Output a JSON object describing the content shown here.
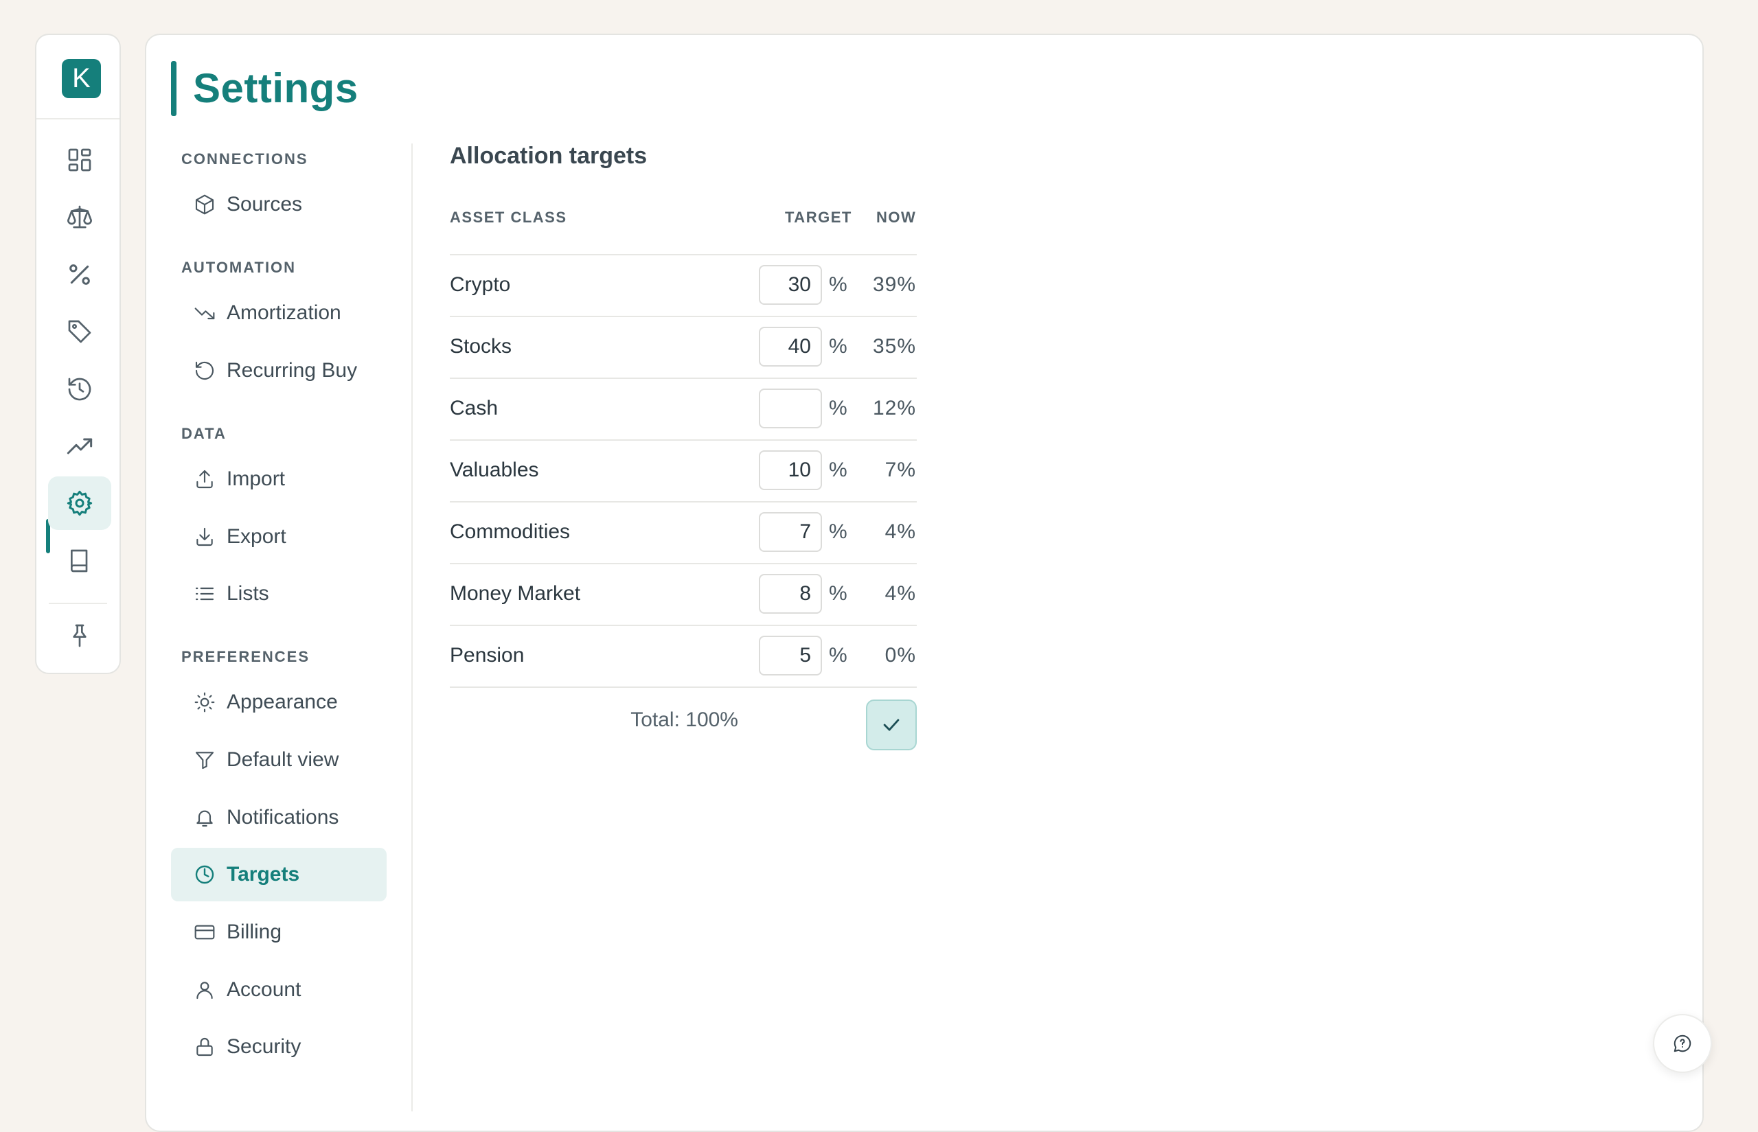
{
  "app": {
    "logo_letter": "K",
    "accent": "#157f7b"
  },
  "rail": {
    "items": [
      {
        "icon": "dashboard-icon"
      },
      {
        "icon": "scale-icon"
      },
      {
        "icon": "percent-icon"
      },
      {
        "icon": "tag-icon"
      },
      {
        "icon": "history-icon"
      },
      {
        "icon": "trend-up-icon"
      },
      {
        "icon": "gear-icon",
        "active": true
      },
      {
        "icon": "book-icon"
      },
      {
        "icon": "pin-icon"
      }
    ]
  },
  "page": {
    "title": "Settings"
  },
  "settings_nav": {
    "sections": {
      "connections": "CONNECTIONS",
      "automation": "AUTOMATION",
      "data": "DATA",
      "preferences": "PREFERENCES"
    },
    "items": {
      "sources": "Sources",
      "amortization": "Amortization",
      "recurring_buy": "Recurring Buy",
      "import": "Import",
      "export": "Export",
      "lists": "Lists",
      "appearance": "Appearance",
      "default_view": "Default view",
      "notifications": "Notifications",
      "targets": "Targets",
      "billing": "Billing",
      "account": "Account",
      "security": "Security"
    },
    "active": "targets"
  },
  "targets": {
    "title": "Allocation targets",
    "headers": {
      "asset_class": "ASSET CLASS",
      "target": "TARGET",
      "now": "NOW"
    },
    "rows": [
      {
        "label": "Crypto",
        "target": "30",
        "unit": "%",
        "now": "39%"
      },
      {
        "label": "Stocks",
        "target": "40",
        "unit": "%",
        "now": "35%"
      },
      {
        "label": "Cash",
        "target": "",
        "unit": "%",
        "now": "12%"
      },
      {
        "label": "Valuables",
        "target": "10",
        "unit": "%",
        "now": "7%"
      },
      {
        "label": "Commodities",
        "target": "7",
        "unit": "%",
        "now": "4%"
      },
      {
        "label": "Money Market",
        "target": "8",
        "unit": "%",
        "now": "4%"
      },
      {
        "label": "Pension",
        "target": "5",
        "unit": "%",
        "now": "0%"
      }
    ],
    "total": "Total: 100%"
  }
}
